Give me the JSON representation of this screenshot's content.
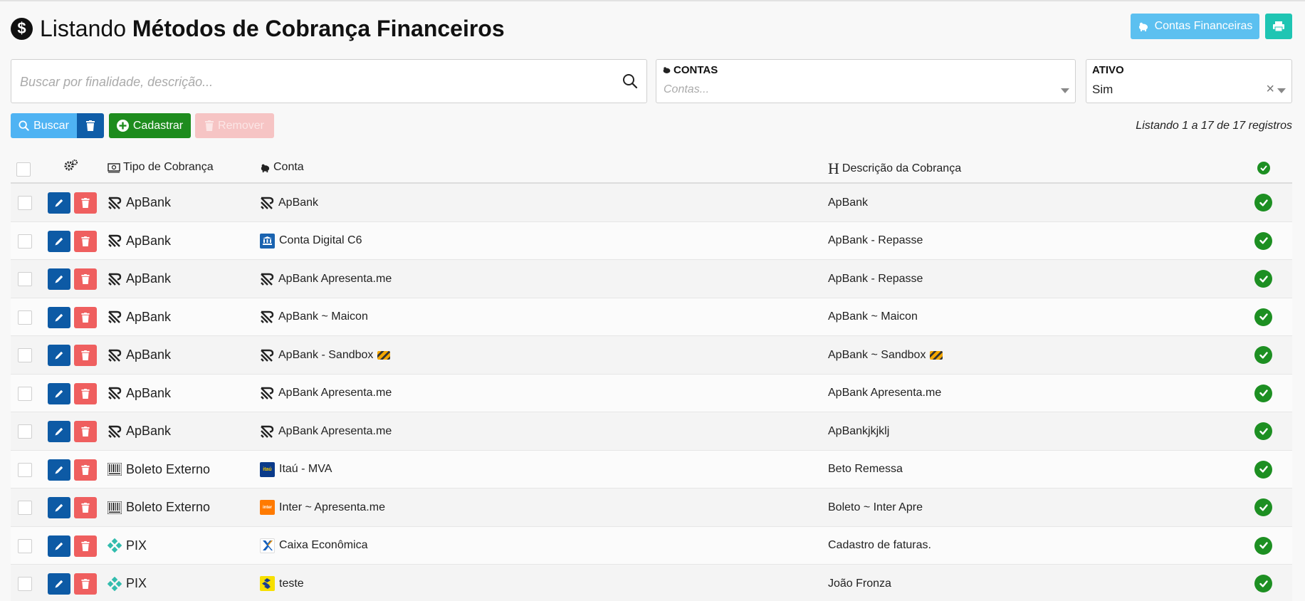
{
  "header": {
    "title_prefix": "Listando",
    "title_main": "Métodos de Cobrança Financeiros",
    "contas_button": "Contas Financeiras",
    "print_button_icon": "printer-icon"
  },
  "filters": {
    "search_placeholder": "Buscar por finalidade, descrição...",
    "search_value": "",
    "contas": {
      "label": "CONTAS",
      "placeholder": "Contas..."
    },
    "ativo": {
      "label": "ATIVO",
      "value": "Sim"
    }
  },
  "actions": {
    "buscar": "Buscar",
    "cadastrar": "Cadastrar",
    "remover": "Remover",
    "listing_info": "Listando 1 a 17 de 17 registros"
  },
  "table": {
    "headers": {
      "tipo": "Tipo de Cobrança",
      "conta": "Conta",
      "descricao": "Descrição da Cobrança"
    },
    "rows": [
      {
        "tipo": "ApBank",
        "tipo_icon": "apbank-logo-icon",
        "conta": "ApBank",
        "conta_icon": "apbank-logo-icon",
        "descricao": "ApBank",
        "ativo": true
      },
      {
        "tipo": "ApBank",
        "tipo_icon": "apbank-logo-icon",
        "conta": "Conta Digital C6",
        "conta_icon": "bank-building-icon",
        "descricao": "ApBank - Repasse",
        "ativo": true
      },
      {
        "tipo": "ApBank",
        "tipo_icon": "apbank-logo-icon",
        "conta": "ApBank Apresenta.me",
        "conta_icon": "apbank-logo-icon",
        "descricao": "ApBank - Repasse",
        "ativo": true
      },
      {
        "tipo": "ApBank",
        "tipo_icon": "apbank-logo-icon",
        "conta": "ApBank ~ Maicon",
        "conta_icon": "apbank-logo-icon",
        "descricao": "ApBank ~ Maicon",
        "ativo": true
      },
      {
        "tipo": "ApBank",
        "tipo_icon": "apbank-logo-icon",
        "conta": "ApBank - Sandbox",
        "conta_icon": "apbank-logo-icon",
        "descricao": "ApBank ~ Sandbox",
        "ativo": true,
        "barrier": true
      },
      {
        "tipo": "ApBank",
        "tipo_icon": "apbank-logo-icon",
        "conta": "ApBank Apresenta.me",
        "conta_icon": "apbank-logo-icon",
        "descricao": "ApBank Apresenta.me",
        "ativo": true
      },
      {
        "tipo": "ApBank",
        "tipo_icon": "apbank-logo-icon",
        "conta": "ApBank Apresenta.me",
        "conta_icon": "apbank-logo-icon",
        "descricao": "ApBankjkjklj",
        "ativo": true
      },
      {
        "tipo": "Boleto Externo",
        "tipo_icon": "barcode-icon",
        "conta": "Itaú - MVA",
        "conta_icon": "itau-logo-icon",
        "descricao": "Beto Remessa",
        "ativo": true
      },
      {
        "tipo": "Boleto Externo",
        "tipo_icon": "barcode-icon",
        "conta": "Inter ~ Apresenta.me",
        "conta_icon": "inter-logo-icon",
        "descricao": "Boleto ~ Inter Apre",
        "ativo": true
      },
      {
        "tipo": "PIX",
        "tipo_icon": "pix-icon",
        "conta": "Caixa Econômica",
        "conta_icon": "caixa-logo-icon",
        "descricao": "Cadastro de faturas.",
        "ativo": true
      },
      {
        "tipo": "PIX",
        "tipo_icon": "pix-icon",
        "conta": "teste",
        "conta_icon": "banco-do-brasil-logo-icon",
        "descricao": "João Fronza",
        "ativo": true
      }
    ]
  },
  "colors": {
    "primary_blue": "#0d5aa5",
    "info_blue": "#4fb3f3",
    "success_green": "#1e8c1e",
    "danger_red": "#ef5f5f",
    "teal": "#1fc5b3"
  }
}
